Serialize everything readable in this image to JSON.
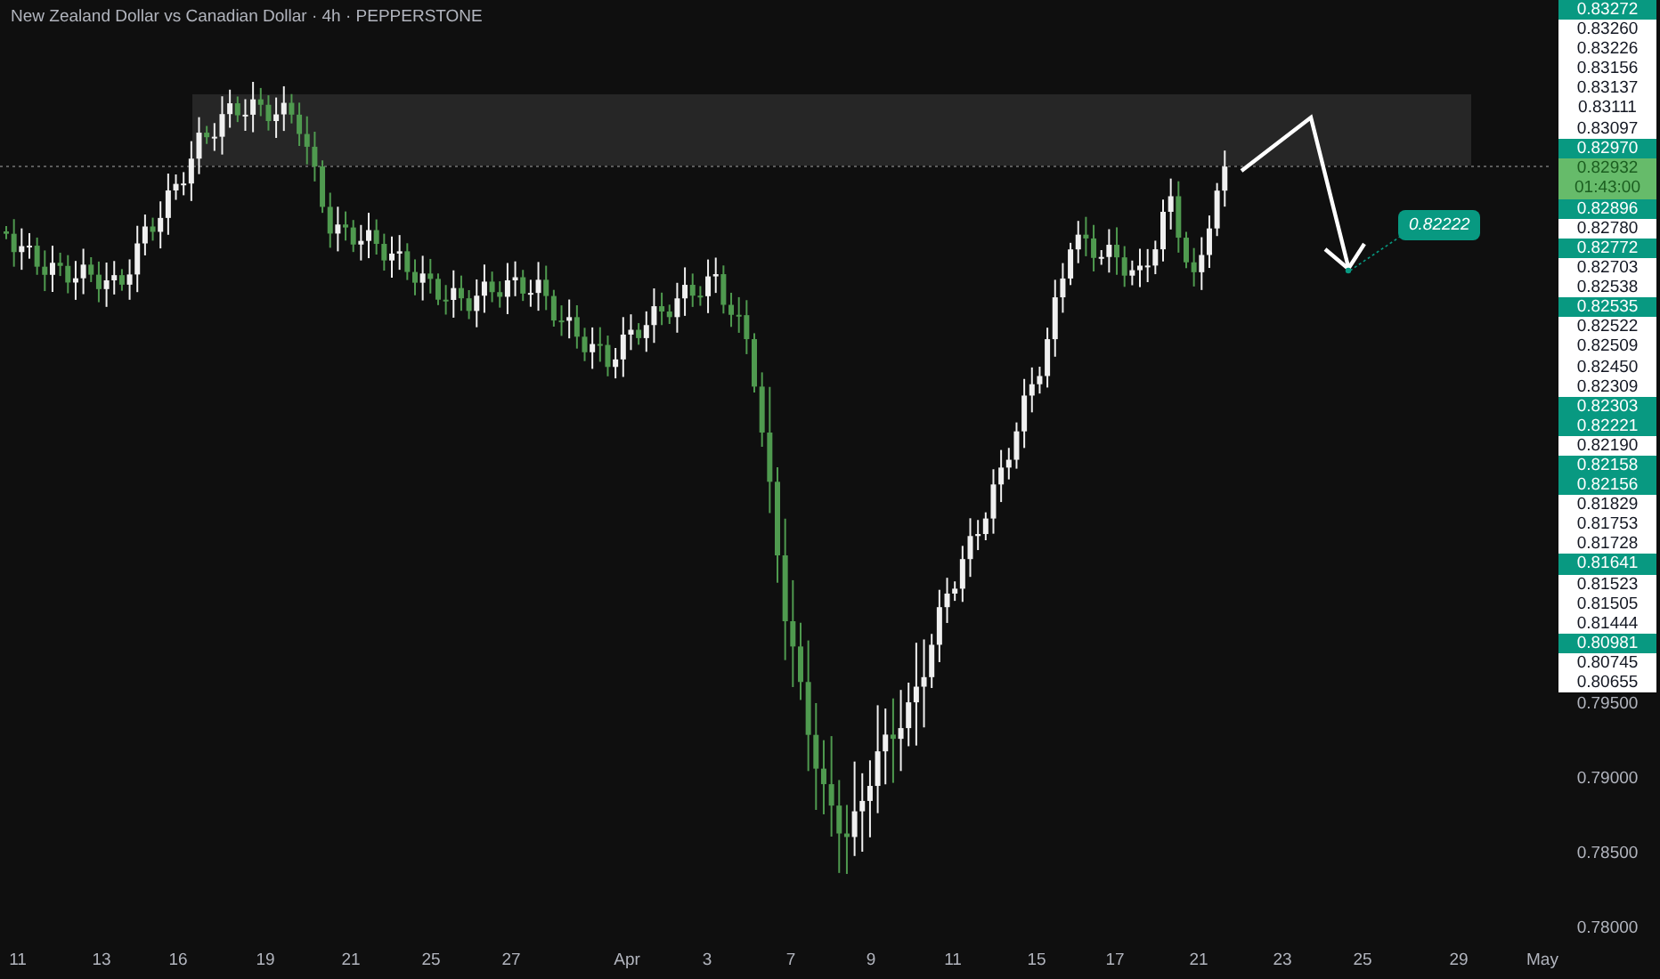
{
  "chart_title": "New Zealand Dollar vs Canadian Dollar · 4h · PEPPERSTONE",
  "price_axis": {
    "labels": [
      {
        "text": "0.83272",
        "kind": "highlight"
      },
      {
        "text": "0.83260",
        "kind": "plain"
      },
      {
        "text": "0.83226",
        "kind": "plain"
      },
      {
        "text": "0.83156",
        "kind": "plain"
      },
      {
        "text": "0.83137",
        "kind": "plain"
      },
      {
        "text": "0.83111",
        "kind": "plain"
      },
      {
        "text": "0.83097",
        "kind": "plain"
      },
      {
        "text": "0.82970",
        "kind": "highlight"
      },
      {
        "text": "0.82932",
        "kind": "current",
        "countdown": "01:43:00"
      },
      {
        "text": "0.82896",
        "kind": "highlight"
      },
      {
        "text": "0.82780",
        "kind": "plain"
      },
      {
        "text": "0.82772",
        "kind": "highlight"
      },
      {
        "text": "0.82703",
        "kind": "plain"
      },
      {
        "text": "0.82538",
        "kind": "plain"
      },
      {
        "text": "0.82535",
        "kind": "highlight"
      },
      {
        "text": "0.82522",
        "kind": "plain"
      },
      {
        "text": "0.82509",
        "kind": "plain"
      },
      {
        "text": "0.82450",
        "kind": "plain"
      },
      {
        "text": "0.82309",
        "kind": "plain"
      },
      {
        "text": "0.82303",
        "kind": "highlight"
      },
      {
        "text": "0.82221",
        "kind": "highlight"
      },
      {
        "text": "0.82190",
        "kind": "plain"
      },
      {
        "text": "0.82158",
        "kind": "highlight"
      },
      {
        "text": "0.82156",
        "kind": "highlight"
      },
      {
        "text": "0.81829",
        "kind": "plain"
      },
      {
        "text": "0.81753",
        "kind": "plain"
      },
      {
        "text": "0.81728",
        "kind": "plain"
      },
      {
        "text": "0.81641",
        "kind": "highlight"
      },
      {
        "text": "0.81523",
        "kind": "plain"
      },
      {
        "text": "0.81505",
        "kind": "plain"
      },
      {
        "text": "0.81444",
        "kind": "plain"
      },
      {
        "text": "0.80981",
        "kind": "highlight"
      },
      {
        "text": "0.80745",
        "kind": "plain"
      },
      {
        "text": "0.80655",
        "kind": "plain"
      },
      {
        "text": "0.79500",
        "kind": "scale"
      },
      {
        "text": "0.79000",
        "kind": "scale"
      },
      {
        "text": "0.78500",
        "kind": "scale"
      },
      {
        "text": "0.78000",
        "kind": "scale"
      }
    ]
  },
  "time_axis": {
    "labels": [
      "11",
      "13",
      "16",
      "19",
      "21",
      "25",
      "27",
      "Apr",
      "3",
      "7",
      "9",
      "11",
      "15",
      "17",
      "21",
      "23",
      "25",
      "29",
      "May"
    ]
  },
  "target_label": "0.82222"
}
